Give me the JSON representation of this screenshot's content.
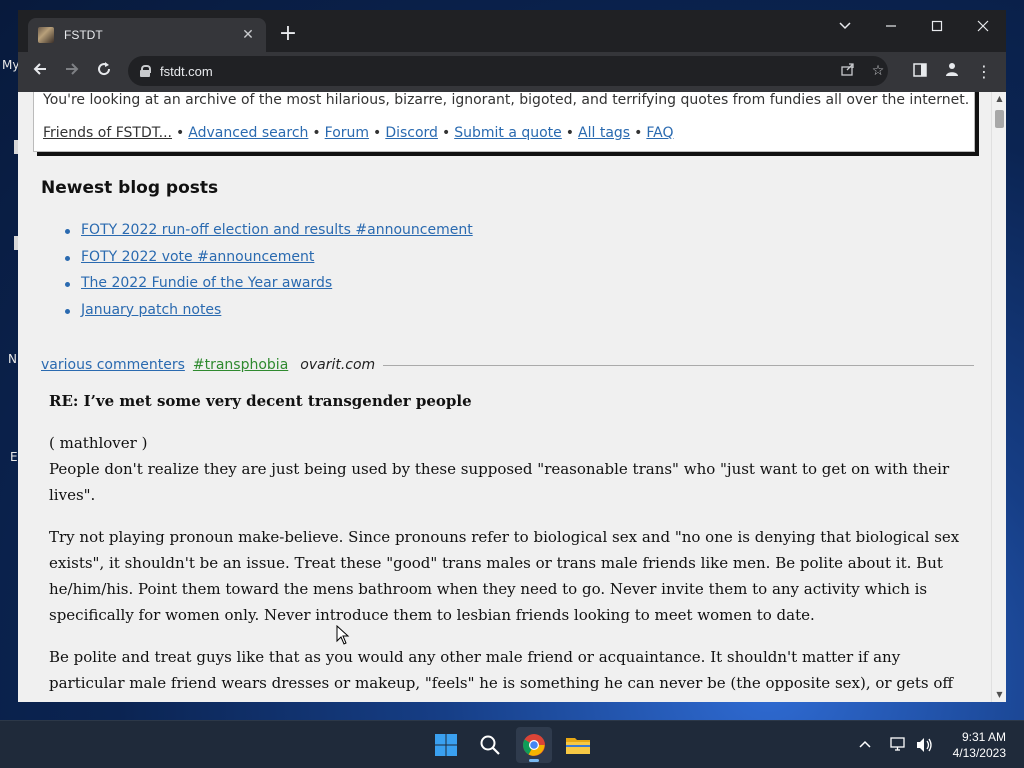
{
  "desktop": {
    "fragments": [
      "My",
      "N",
      "E"
    ]
  },
  "browser": {
    "tab_title": "FSTDT",
    "url": "fstdt.com"
  },
  "page": {
    "intro_text": "You're looking at an archive of the most hilarious, bizarre, ignorant, bigoted, and terrifying quotes from fundies all over the internet.",
    "nav": {
      "friends": "Friends of FSTDT...",
      "advanced_search": "Advanced search",
      "forum": "Forum",
      "discord": "Discord",
      "submit": "Submit a quote",
      "all_tags": "All tags",
      "faq": "FAQ",
      "separator": "•"
    },
    "blog_heading": "Newest blog posts",
    "blog_posts": [
      "FOTY 2022 run-off election and results #announcement",
      "FOTY 2022 vote #announcement",
      "The 2022 Fundie of the Year awards",
      "January patch notes"
    ],
    "quote": {
      "author": "various commenters",
      "tag": "#transphobia",
      "source": "ovarit.com",
      "title": "RE: I’ve met some very decent transgender people",
      "user": "( mathlover )",
      "lines": [
        "People don't realize they are just being used by these supposed \"reasonable trans\" who \"just want to get on with their lives\".",
        "Try not playing pronoun make-believe. Since pronouns refer to biological sex and \"no one is denying that biological sex exists\", it shouldn't be an issue. Treat these \"good\" trans males or trans male friends like men. Be polite about it. But he/him/his. Point them toward the mens bathroom when they need to go. Never invite them to any activity which is specifically for women only. Never introduce them to lesbian friends looking to meet women to date.",
        "Be polite and treat guys like that as you would any other male friend or acquaintance. It shouldn't matter if any particular male friend wears dresses or makeup, \"feels\" he is something he can never be (the opposite sex), or gets off on pretending he is a woman. See what happens if you don't go along with the make-believe. Because the mask will slip from that \"lovely trans\" male"
      ]
    }
  },
  "taskbar": {
    "time": "9:31 AM",
    "date": "4/13/2023"
  },
  "colors": {
    "link": "#2a6ab0",
    "tag": "#2f8a2f",
    "chrome_dark": "#202124",
    "chrome_toolbar": "#35363a"
  }
}
